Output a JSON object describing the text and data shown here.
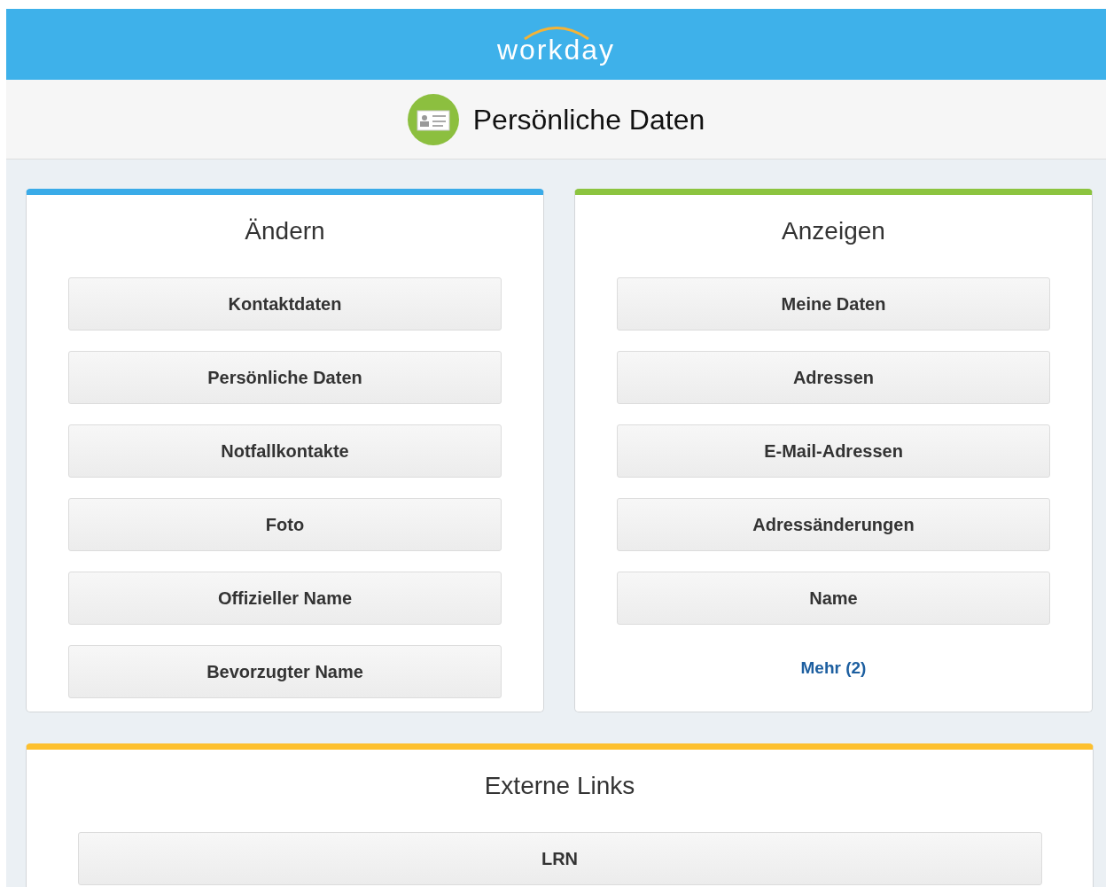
{
  "header": {
    "logo": "workday"
  },
  "page_title": "Persönliche Daten",
  "cards": [
    {
      "title": "Ändern",
      "color": "#3aabe8",
      "buttons": [
        "Kontaktdaten",
        "Persönliche Daten",
        "Notfallkontakte",
        "Foto",
        "Offizieller Name",
        "Bevorzugter Name"
      ]
    },
    {
      "title": "Anzeigen",
      "color": "#8cc43f",
      "buttons": [
        "Meine Daten",
        "Adressen",
        "E-Mail-Adressen",
        "Adressänderungen",
        "Name"
      ],
      "more_link": "Mehr (2)"
    }
  ],
  "bottom_card": {
    "title": "Externe Links",
    "color": "#fdc02e",
    "buttons": [
      "LRN"
    ]
  }
}
